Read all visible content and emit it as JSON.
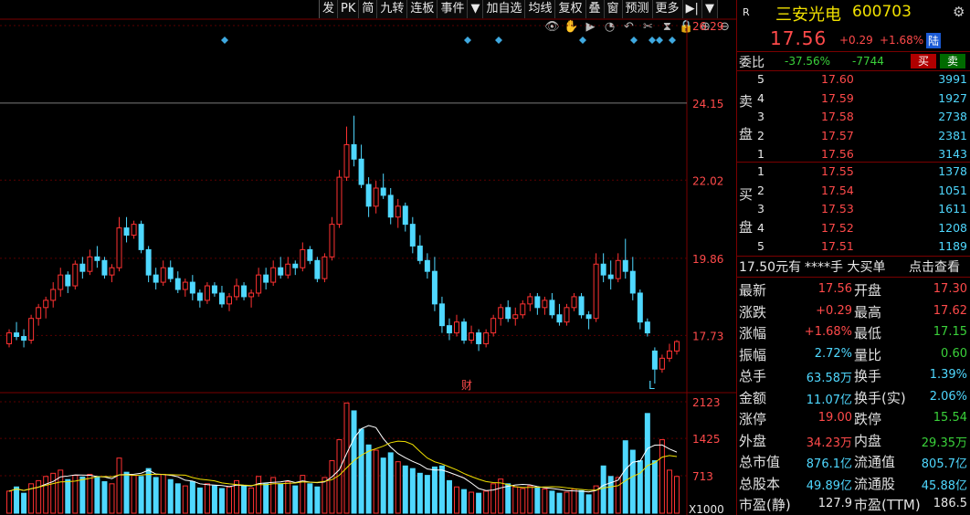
{
  "toolbar": {
    "items": [
      "发",
      "PK",
      "简",
      "九转",
      "连板",
      "事件",
      "▼",
      "加自选",
      "均线",
      "复权",
      "叠",
      "窗",
      "预测",
      "更多",
      "▶|",
      "▼"
    ]
  },
  "chart_icons": [
    "eye-icon",
    "hand-icon",
    "play-icon",
    "clock-icon",
    "undo-icon",
    "scissors-icon",
    "hourglass-icon",
    "lock-icon",
    "zoom-in-icon",
    "zoom-out-icon"
  ],
  "chart_data": [
    {
      "type": "candlestick",
      "y_axis_labels": [
        "26.29",
        "24.15",
        "22.02",
        "19.86",
        "17.73"
      ],
      "ylim": [
        16.2,
        26.29
      ],
      "markers": [
        "财",
        "L"
      ],
      "up_color": "#ff3232",
      "down_color": "#4fd8ff",
      "candles": [
        [
          17.5,
          17.9,
          17.4,
          17.8
        ],
        [
          17.8,
          18.1,
          17.6,
          17.7
        ],
        [
          17.7,
          17.9,
          17.4,
          17.6
        ],
        [
          17.6,
          18.3,
          17.5,
          18.2
        ],
        [
          18.2,
          18.6,
          18.0,
          18.5
        ],
        [
          18.5,
          18.8,
          18.2,
          18.7
        ],
        [
          18.7,
          19.2,
          18.5,
          19.0
        ],
        [
          19.0,
          19.6,
          18.8,
          19.4
        ],
        [
          19.4,
          19.5,
          18.9,
          19.1
        ],
        [
          19.1,
          19.8,
          19.0,
          19.7
        ],
        [
          19.7,
          19.9,
          19.3,
          19.5
        ],
        [
          19.5,
          20.1,
          19.4,
          19.9
        ],
        [
          19.9,
          20.2,
          19.6,
          19.8
        ],
        [
          19.8,
          19.9,
          19.3,
          19.4
        ],
        [
          19.4,
          19.7,
          19.2,
          19.6
        ],
        [
          19.6,
          21.0,
          19.5,
          20.7
        ],
        [
          20.7,
          21.0,
          20.3,
          20.5
        ],
        [
          20.5,
          20.9,
          20.4,
          20.8
        ],
        [
          20.8,
          20.9,
          20.0,
          20.1
        ],
        [
          20.1,
          20.2,
          19.2,
          19.4
        ],
        [
          19.4,
          19.6,
          19.0,
          19.2
        ],
        [
          19.2,
          19.8,
          19.1,
          19.6
        ],
        [
          19.6,
          19.8,
          19.2,
          19.3
        ],
        [
          19.3,
          19.5,
          18.9,
          19.0
        ],
        [
          19.0,
          19.3,
          18.8,
          19.2
        ],
        [
          19.2,
          19.4,
          18.7,
          18.9
        ],
        [
          18.9,
          19.0,
          18.5,
          18.7
        ],
        [
          18.7,
          19.2,
          18.6,
          19.1
        ],
        [
          19.1,
          19.2,
          18.8,
          18.9
        ],
        [
          18.9,
          19.1,
          18.5,
          18.6
        ],
        [
          18.6,
          18.9,
          18.4,
          18.8
        ],
        [
          18.8,
          19.3,
          18.7,
          19.1
        ],
        [
          19.1,
          19.2,
          18.7,
          18.8
        ],
        [
          18.8,
          19.0,
          18.5,
          18.9
        ],
        [
          18.9,
          19.6,
          18.8,
          19.4
        ],
        [
          19.4,
          19.6,
          19.0,
          19.2
        ],
        [
          19.2,
          19.8,
          19.1,
          19.6
        ],
        [
          19.6,
          19.9,
          19.3,
          19.4
        ],
        [
          19.4,
          19.9,
          19.3,
          19.7
        ],
        [
          19.7,
          19.8,
          19.4,
          19.6
        ],
        [
          19.6,
          20.3,
          19.5,
          20.1
        ],
        [
          20.1,
          20.2,
          19.7,
          19.8
        ],
        [
          19.8,
          19.9,
          19.2,
          19.3
        ],
        [
          19.3,
          20.0,
          19.2,
          19.9
        ],
        [
          19.9,
          21.0,
          19.8,
          20.8
        ],
        [
          20.8,
          22.3,
          20.7,
          22.1
        ],
        [
          22.1,
          23.5,
          22.0,
          23.0
        ],
        [
          23.0,
          23.8,
          22.4,
          22.6
        ],
        [
          22.6,
          23.0,
          21.8,
          21.9
        ],
        [
          21.9,
          22.1,
          21.0,
          21.3
        ],
        [
          21.3,
          22.0,
          21.1,
          21.8
        ],
        [
          21.8,
          22.2,
          21.5,
          21.6
        ],
        [
          21.6,
          21.8,
          20.8,
          21.0
        ],
        [
          21.0,
          21.5,
          20.7,
          21.3
        ],
        [
          21.3,
          21.4,
          20.6,
          20.8
        ],
        [
          20.8,
          21.0,
          20.0,
          20.2
        ],
        [
          20.2,
          20.5,
          19.7,
          19.8
        ],
        [
          19.8,
          20.0,
          19.3,
          19.5
        ],
        [
          19.5,
          19.9,
          18.4,
          18.6
        ],
        [
          18.6,
          18.8,
          17.8,
          18.0
        ],
        [
          18.0,
          18.2,
          17.6,
          17.8
        ],
        [
          17.8,
          18.3,
          17.7,
          18.1
        ],
        [
          18.1,
          18.2,
          17.5,
          17.6
        ],
        [
          17.6,
          18.0,
          17.5,
          17.8
        ],
        [
          17.8,
          17.9,
          17.3,
          17.5
        ],
        [
          17.5,
          17.9,
          17.4,
          17.8
        ],
        [
          17.8,
          18.3,
          17.7,
          18.2
        ],
        [
          18.2,
          18.6,
          18.0,
          18.5
        ],
        [
          18.5,
          18.7,
          18.1,
          18.2
        ],
        [
          18.2,
          18.5,
          18.0,
          18.3
        ],
        [
          18.3,
          18.7,
          18.2,
          18.6
        ],
        [
          18.6,
          18.9,
          18.4,
          18.8
        ],
        [
          18.8,
          18.9,
          18.3,
          18.5
        ],
        [
          18.5,
          18.8,
          18.3,
          18.7
        ],
        [
          18.7,
          18.9,
          18.2,
          18.3
        ],
        [
          18.3,
          18.6,
          18.0,
          18.1
        ],
        [
          18.1,
          18.6,
          18.0,
          18.5
        ],
        [
          18.5,
          18.9,
          18.4,
          18.8
        ],
        [
          18.8,
          18.9,
          18.2,
          18.3
        ],
        [
          18.3,
          18.4,
          17.9,
          18.2
        ],
        [
          18.2,
          20.0,
          18.1,
          19.7
        ],
        [
          19.7,
          20.0,
          19.2,
          19.4
        ],
        [
          19.4,
          19.8,
          19.0,
          19.3
        ],
        [
          19.3,
          20.0,
          19.2,
          19.8
        ],
        [
          19.8,
          20.4,
          19.3,
          19.5
        ],
        [
          19.5,
          19.9,
          18.7,
          18.9
        ],
        [
          18.9,
          19.0,
          17.9,
          18.1
        ],
        [
          18.1,
          18.2,
          17.7,
          17.8
        ],
        [
          17.3,
          17.4,
          16.4,
          16.8
        ],
        [
          16.8,
          17.2,
          16.7,
          17.1
        ],
        [
          17.1,
          17.5,
          17.0,
          17.3
        ],
        [
          17.3,
          17.6,
          17.2,
          17.56
        ]
      ]
    },
    {
      "type": "bar",
      "y_axis_labels": [
        "2123",
        "1425",
        "713",
        "X1000"
      ],
      "ylim": [
        0,
        2123
      ],
      "series_colors": [
        "#ff3232",
        "#4fd8ff"
      ],
      "volumes": [
        420,
        500,
        380,
        560,
        620,
        700,
        760,
        820,
        640,
        720,
        690,
        740,
        700,
        600,
        560,
        1050,
        780,
        720,
        700,
        850,
        680,
        740,
        640,
        560,
        520,
        600,
        480,
        560,
        520,
        470,
        500,
        620,
        520,
        480,
        700,
        560,
        680,
        560,
        600,
        520,
        720,
        560,
        500,
        680,
        1000,
        1400,
        2100,
        1950,
        1600,
        1300,
        1200,
        1050,
        1150,
        980,
        900,
        850,
        760,
        720,
        880,
        900,
        620,
        500,
        450,
        400,
        380,
        420,
        560,
        650,
        560,
        500,
        470,
        520,
        480,
        460,
        420,
        380,
        400,
        460,
        430,
        350,
        520,
        900,
        700,
        680,
        1380,
        1200,
        1000,
        1900,
        1000,
        1400,
        820,
        700
      ]
    }
  ],
  "panel": {
    "badge": "R",
    "stock_name": "三安光电",
    "stock_code": "600703",
    "price": "17.56",
    "change": "+0.29",
    "change_pct": "+1.68%",
    "market_tag": "陆",
    "gear_icon": "gear-icon",
    "weibi_label": "委比",
    "weibi_pct": "-37.56%",
    "weibi_diff": "-7744",
    "buy_btn": "买",
    "sell_btn": "卖",
    "sell_label": [
      "卖",
      "盘"
    ],
    "buy_label": [
      "买",
      "盘"
    ],
    "asks": [
      {
        "lvl": "5",
        "price": "17.60",
        "vol": "3991"
      },
      {
        "lvl": "4",
        "price": "17.59",
        "vol": "1927"
      },
      {
        "lvl": "3",
        "price": "17.58",
        "vol": "2738"
      },
      {
        "lvl": "2",
        "price": "17.57",
        "vol": "2381"
      },
      {
        "lvl": "1",
        "price": "17.56",
        "vol": "3143"
      }
    ],
    "bids": [
      {
        "lvl": "1",
        "price": "17.55",
        "vol": "1378"
      },
      {
        "lvl": "2",
        "price": "17.54",
        "vol": "1051"
      },
      {
        "lvl": "3",
        "price": "17.53",
        "vol": "1611"
      },
      {
        "lvl": "4",
        "price": "17.52",
        "vol": "1208"
      },
      {
        "lvl": "5",
        "price": "17.51",
        "vol": "1189"
      }
    ],
    "info_left": "17.50元有",
    "info_mid": "****手 大买单",
    "info_right": "点击查看",
    "stats": [
      {
        "l1": "最新",
        "v1": "17.56",
        "c1": "red",
        "l2": "开盘",
        "v2": "17.30",
        "c2": "red"
      },
      {
        "l1": "涨跌",
        "v1": "+0.29",
        "c1": "red",
        "l2": "最高",
        "v2": "17.62",
        "c2": "red"
      },
      {
        "l1": "涨幅",
        "v1": "+1.68%",
        "c1": "red",
        "l2": "最低",
        "v2": "17.15",
        "c2": "green"
      },
      {
        "l1": "振幅",
        "v1": "2.72%",
        "c1": "cyan",
        "l2": "量比",
        "v2": "0.60",
        "c2": "green"
      },
      {
        "l1": "总手",
        "v1": "63.58万",
        "c1": "cyan",
        "l2": "换手",
        "v2": "1.39%",
        "c2": "cyan"
      },
      {
        "l1": "金额",
        "v1": "11.07亿",
        "c1": "cyan",
        "l2": "换手(实)",
        "v2": "2.06%",
        "c2": "cyan"
      },
      {
        "l1": "涨停",
        "v1": "19.00",
        "c1": "red",
        "l2": "跌停",
        "v2": "15.54",
        "c2": "green"
      },
      {
        "l1": "外盘",
        "v1": "34.23万",
        "c1": "red",
        "l2": "内盘",
        "v2": "29.35万",
        "c2": "green"
      },
      {
        "l1": "总市值",
        "v1": "876.1亿",
        "c1": "cyan",
        "l2": "流通值",
        "v2": "805.7亿",
        "c2": "cyan"
      },
      {
        "l1": "总股本",
        "v1": "49.89亿",
        "c1": "cyan",
        "l2": "流通股",
        "v2": "45.88亿",
        "c2": "cyan"
      },
      {
        "l1": "市盈(静)",
        "v1": "127.9",
        "c1": "white",
        "l2": "市盈(TTM)",
        "v2": "186.5",
        "c2": "white"
      }
    ]
  }
}
